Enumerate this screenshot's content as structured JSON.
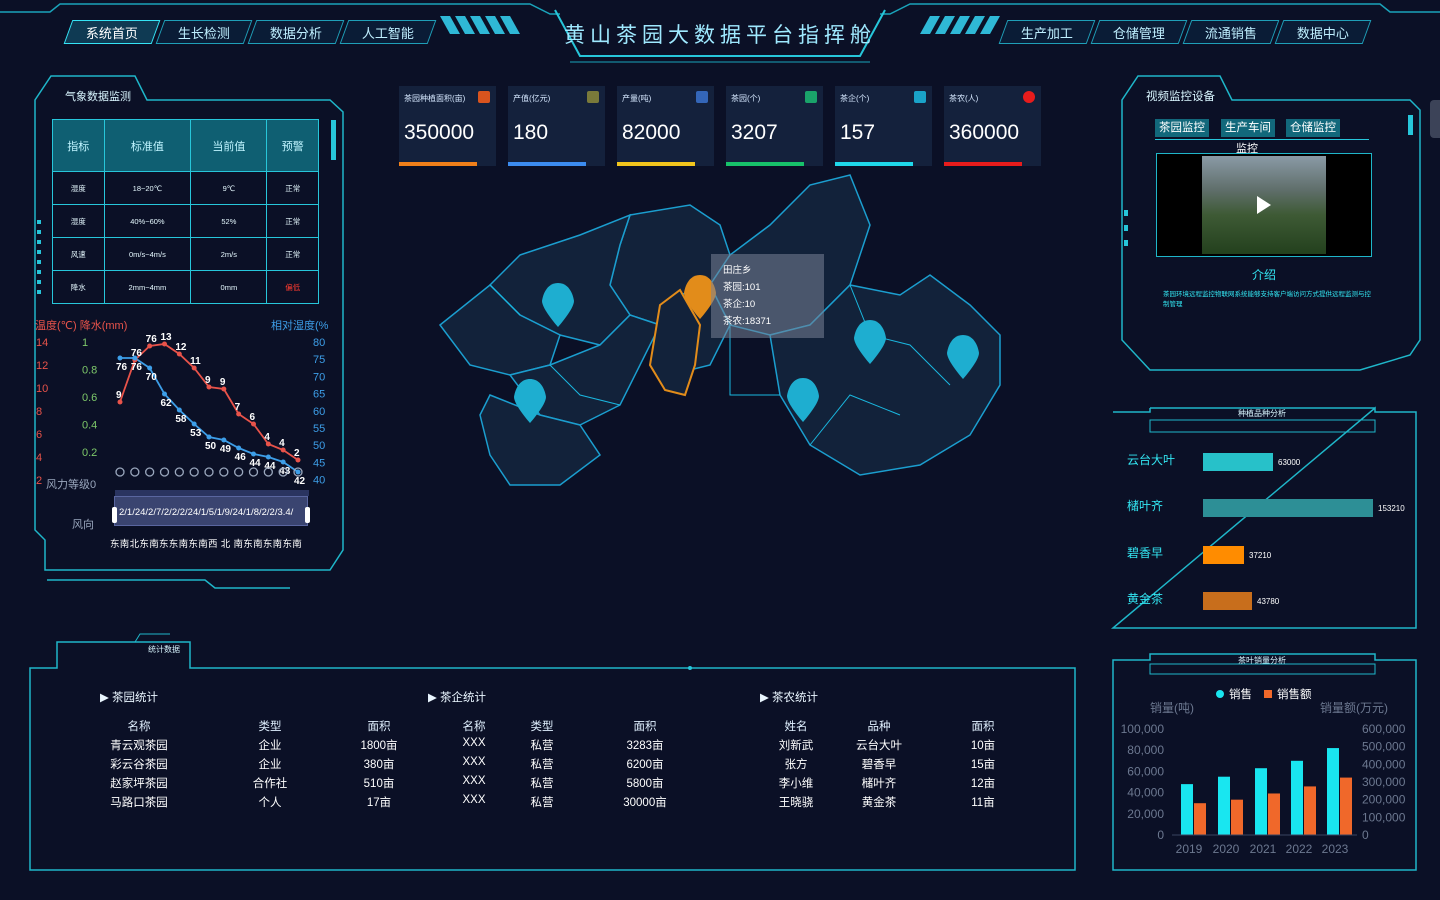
{
  "header": {
    "title": "黄山茶园大数据平台指挥舱",
    "nav_left": [
      "系统首页",
      "生长检测",
      "数据分析",
      "人工智能"
    ],
    "nav_right": [
      "生产加工",
      "仓储管理",
      "流通销售",
      "数据中心"
    ]
  },
  "weather": {
    "title": "气象数据监测",
    "headers": [
      "指标",
      "标准值",
      "当前值",
      "预警"
    ],
    "rows": [
      [
        "湿度",
        "18~20℃",
        "9℃",
        "正常"
      ],
      [
        "湿度",
        "40%~60%",
        "52%",
        "正常"
      ],
      [
        "风速",
        "0m/s~4m/s",
        "2m/s",
        "正常"
      ],
      [
        "降水",
        "2mm~4mm",
        "0mm",
        "偏低"
      ]
    ],
    "alert_color": "#ff3b30"
  },
  "weather_chart": {
    "label_left": "温度(℃) 降水(mm)",
    "label_right": "相对湿度(%",
    "label_wind_level": "风力等级0",
    "label_wind_dir": "风向",
    "temp_ticks": [
      "14",
      "12",
      "10",
      "8",
      "6",
      "4",
      "2"
    ],
    "rain_ticks": [
      "1",
      "0.8",
      "0.6",
      "0.4",
      "0.2"
    ],
    "humidity_ticks": [
      "80",
      "75",
      "70",
      "65",
      "60",
      "55",
      "50",
      "45",
      "40"
    ],
    "dates": "2/1/24/2/7/2/2/2/24/1/5/1/9/24/1/8/2/2/3.4/",
    "wind_dirs": "东南北东南东东南东南西 北 南东南东南东南"
  },
  "chart_data": [
    {
      "type": "line",
      "title": "",
      "xlabel": "",
      "ylabel": "温度(℃) 降水(mm)",
      "y2label": "相对湿度(%",
      "ylim": [
        2,
        14
      ],
      "y2lim": [
        40,
        80
      ],
      "series": [
        {
          "name": "",
          "color": "#e8534a",
          "values": [
            9,
            70,
            76,
            13,
            12,
            11,
            9,
            9,
            7,
            6,
            4,
            4,
            2
          ]
        },
        {
          "name": "",
          "color": "#3d9ee8",
          "values": [
            76,
            76,
            70,
            62,
            58,
            53,
            50,
            48,
            46,
            45,
            44,
            43,
            42
          ]
        }
      ],
      "labels_red": [
        "9",
        "76",
        "76",
        "13",
        "12",
        "11",
        "9",
        "9",
        "7",
        "6",
        "4",
        "4",
        "2"
      ],
      "labels_blue": [
        "76",
        "76",
        "70",
        "62",
        "58",
        "53",
        "50",
        "49",
        "46",
        "44",
        "44",
        "43",
        "42"
      ]
    },
    {
      "type": "bar",
      "title": "种植品种分析",
      "categories": [
        "云台大叶",
        "槠叶齐",
        "碧香早",
        "黄金茶"
      ],
      "values": [
        63000,
        153210,
        37210,
        43780
      ],
      "colors": [
        "#27c1c9",
        "#2d8f96",
        "#ff8c00",
        "#c86e1c"
      ]
    },
    {
      "type": "bar",
      "title": "茶叶销量分析",
      "categories": [
        "2019",
        "2020",
        "2021",
        "2022",
        "2023"
      ],
      "ylabel": "销量(吨)",
      "y2label": "销量额(万元)",
      "ylim": [
        0,
        100000
      ],
      "y2lim": [
        0,
        600000
      ],
      "y_ticks": [
        "100,000",
        "80,000",
        "60,000",
        "40,000",
        "20,000",
        "0"
      ],
      "y2_ticks": [
        "600,000",
        "500,000",
        "400,000",
        "300,000",
        "200,000",
        "100,000",
        "0"
      ],
      "series": [
        {
          "name": "销售",
          "color": "#19e6f0",
          "values": [
            48000,
            55000,
            63000,
            70000,
            82000
          ]
        },
        {
          "name": "销售额",
          "color": "#f0682a",
          "values": [
            180000,
            200000,
            235000,
            275000,
            325000
          ]
        }
      ]
    }
  ],
  "kpis": [
    {
      "label": "茶园种植面积(亩)",
      "value": "350000",
      "color": "#f07f1a",
      "icon": "leaf-icon"
    },
    {
      "label": "产值(亿元)",
      "value": "180",
      "color": "#3c8cf0",
      "icon": "coin-icon"
    },
    {
      "label": "产量(吨)",
      "value": "82000",
      "color": "#f2c51d",
      "icon": "scale-icon"
    },
    {
      "label": "茶园(个)",
      "value": "3207",
      "color": "#17c26a",
      "icon": "garden-icon"
    },
    {
      "label": "茶企(个)",
      "value": "157",
      "color": "#1fd8ea",
      "icon": "building-icon"
    },
    {
      "label": "茶农(人)",
      "value": "360000",
      "color": "#e81c1c",
      "icon": "farmer-icon"
    }
  ],
  "map": {
    "tooltip_title": "田庄乡",
    "tooltip_lines": [
      "茶园:101",
      "茶企:10",
      "茶农:18371"
    ]
  },
  "video": {
    "title": "视频监控设备",
    "tabs": [
      "茶园监控",
      "生产车间",
      "仓储监控"
    ],
    "video_label": "监控",
    "intro_title": "介绍",
    "intro_text": "茶园环境远程监控物联网系统能够支持客户端访问方式提供远程监测与控制管理"
  },
  "variety": {
    "title": "种植品种分析",
    "labels": [
      "云台大叶",
      "槠叶齐",
      "碧香早",
      "黄金茶"
    ],
    "values": [
      "63000",
      "153210",
      "37210",
      "43780"
    ]
  },
  "sales": {
    "title": "茶叶销量分析",
    "legend": [
      "销售",
      "销售额"
    ],
    "ylabel": "销量(吨)",
    "y2label": "销量额(万元)"
  },
  "stats": {
    "title": "统计数据",
    "garden": {
      "title": "茶园统计",
      "headers": [
        "名称",
        "类型",
        "面积"
      ],
      "rows": [
        [
          "青云观茶园",
          "企业",
          "1800亩"
        ],
        [
          "彩云谷茶园",
          "企业",
          "380亩"
        ],
        [
          "赵家坪茶园",
          "合作社",
          "510亩"
        ],
        [
          "马路口茶园",
          "个人",
          "17亩"
        ]
      ]
    },
    "company": {
      "title": "茶企统计",
      "headers": [
        "名称",
        "类型",
        "面积"
      ],
      "rows": [
        [
          "XXX",
          "私营",
          "3283亩"
        ],
        [
          "XXX",
          "私营",
          "6200亩"
        ],
        [
          "XXX",
          "私营",
          "5800亩"
        ],
        [
          "XXX",
          "私营",
          "30000亩"
        ]
      ]
    },
    "farmer": {
      "title": "茶农统计",
      "headers": [
        "姓名",
        "品种",
        "面积"
      ],
      "rows": [
        [
          "刘新武",
          "云台大叶",
          "10亩"
        ],
        [
          "张方",
          "碧香早",
          "15亩"
        ],
        [
          "李小维",
          "槠叶齐",
          "12亩"
        ],
        [
          "王晓骁",
          "黄金茶",
          "11亩"
        ]
      ]
    }
  }
}
